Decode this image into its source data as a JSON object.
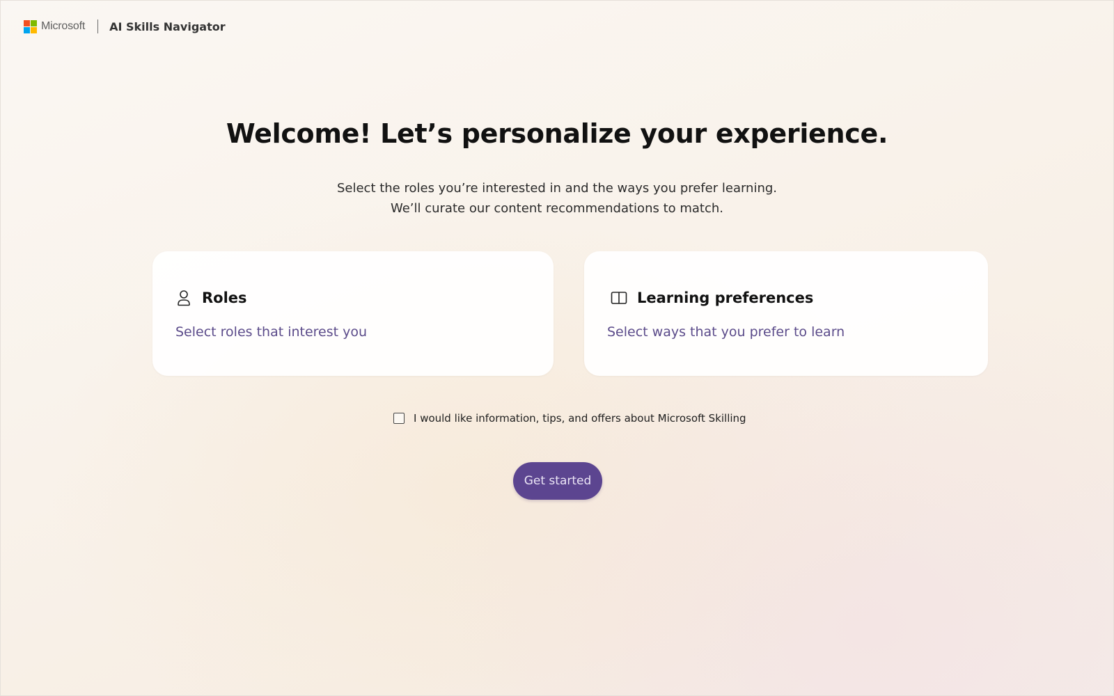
{
  "header": {
    "brand": "Microsoft",
    "app_name": "AI Skills Navigator",
    "logo_colors": [
      "#f25022",
      "#7fba00",
      "#00a4ef",
      "#ffb900"
    ]
  },
  "main": {
    "headline": "Welcome! Let’s personalize your experience.",
    "subtitle_line1": "Select the roles you’re interested in and the ways you prefer learning.",
    "subtitle_line2": "We’ll curate our content recommendations to match."
  },
  "cards": {
    "roles": {
      "icon": "person-icon",
      "title": "Roles",
      "description": "Select roles that interest you"
    },
    "learning": {
      "icon": "book-open-icon",
      "title": "Learning preferences",
      "description": "Select ways that you prefer to learn"
    }
  },
  "consent": {
    "checked": false,
    "label": "I would like information, tips, and offers about Microsoft Skilling"
  },
  "cta": {
    "label": "Get started",
    "color": "#5c4590"
  },
  "colors": {
    "accent_text": "#5b4b8a"
  }
}
